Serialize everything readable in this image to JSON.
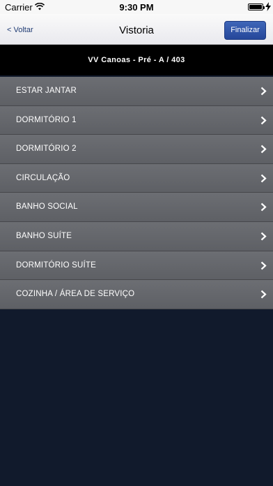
{
  "status_bar": {
    "carrier": "Carrier",
    "time": "9:30 PM"
  },
  "nav": {
    "back_label": "< Voltar",
    "title": "Vistoria",
    "finish_label": "Finalizar"
  },
  "project": {
    "title": "VV Canoas - Pré - A / 403"
  },
  "rooms": [
    {
      "label": "ESTAR JANTAR"
    },
    {
      "label": "DORMITÓRIO 1"
    },
    {
      "label": "DORMITÓRIO 2"
    },
    {
      "label": "CIRCULAÇÃO"
    },
    {
      "label": "BANHO SOCIAL"
    },
    {
      "label": "BANHO SUÍTE"
    },
    {
      "label": "DORMITÓRIO SUÍTE"
    },
    {
      "label": "COZINHA / ÁREA DE SERVIÇO"
    }
  ],
  "colors": {
    "background": "#111a2c",
    "row": "#65676c",
    "finish_button": "#2f55a8",
    "header": "#000000"
  }
}
